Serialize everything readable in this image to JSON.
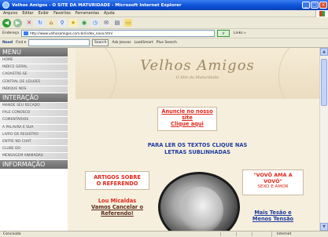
{
  "window": {
    "title": "Velhos Amigos - O SITE DA MATURIDADE - Microsoft Internet Explorer",
    "controls": [
      "_",
      "□",
      "×"
    ]
  },
  "menubar": [
    "Arquivo",
    "Editar",
    "Exibir",
    "Favoritos",
    "Ferramentas",
    "Ajuda"
  ],
  "toolbar": {
    "icons": [
      "back-icon",
      "forward-icon",
      "stop-icon",
      "refresh-icon",
      "home-icon",
      "search-icon",
      "favorites-icon",
      "media-icon",
      "history-icon",
      "mail-icon",
      "print-icon",
      "folder-icon"
    ]
  },
  "addressbar": {
    "label": "Endereço",
    "url": "http://www.velhosamigos.com.br/index_nova.html",
    "go": "Ir",
    "links": "Links »"
  },
  "searchbar": {
    "brand": "Need",
    "menu": "Find ▾",
    "search_button": "Search",
    "items": [
      "Ask Jeeves",
      "LookSmart",
      "Plus Search"
    ]
  },
  "leftmenu": {
    "sections": [
      {
        "title": "MENU",
        "items": [
          "HOME",
          "INDICE GERAL",
          "CADASTRE-SE",
          "CENTRAL DE LEILOES",
          "INDIQUE NOS"
        ]
      },
      {
        "title": "INTERAÇÃO",
        "items": [
          "MANDE SEU RECADO",
          "FALE CONOSCO",
          "COMENTÁRIOS",
          "A PALAVRA É SUA",
          "LIVRO DE REGISTRO",
          "ENTRE NO CHAT",
          "CLUBE DO",
          "MENSAGEM ANIMADAS"
        ]
      },
      {
        "title": "INFORMAÇÃO",
        "items": []
      }
    ]
  },
  "banner": {
    "logo": "Velhos Amigos",
    "tagline": "O Site da Maturidade"
  },
  "content": {
    "cta": [
      "Anuncie no nosso",
      "site",
      "Clique aqui"
    ],
    "read_prompt": [
      "PARA LER OS TEXTOS CLIQUE NAS",
      "LETRAS SUBLINHADAS"
    ],
    "box_left": [
      "ARTIGOS SOBRE",
      "O REFERENDO"
    ],
    "link_left": [
      "Lou Micaldas",
      "Vamos Cancelar o",
      "Referendo!"
    ],
    "box_right": [
      "\"VOVÔ AMA A",
      "VOVÓ\"",
      "SEXO E AMOR"
    ],
    "link_right": [
      "Mais Tesão e",
      "Menos Tensão"
    ]
  },
  "statusbar": {
    "status": "Concluído",
    "zone": "Internet"
  },
  "colors": {
    "titlebar": "#0a4fd6",
    "menu_section": "#7a7a7a",
    "page_bg": "#f7efdd",
    "red_text": "#e0261a",
    "blue_text": "#1e3ca0"
  }
}
